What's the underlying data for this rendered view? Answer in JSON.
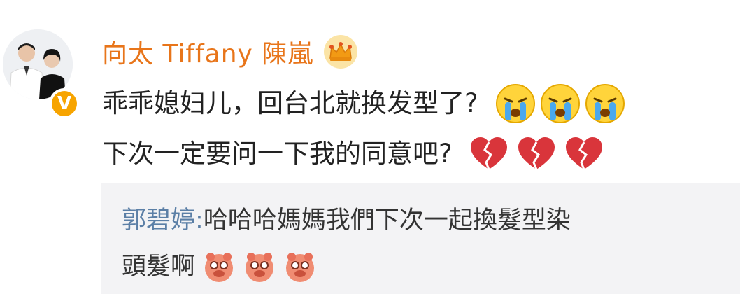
{
  "comment": {
    "author": "向太 Tiffany 陳嵐",
    "author_badge_icon": "crown-icon",
    "verified_badge_letter": "V",
    "lines": [
      {
        "text": "乖乖媳妇儿，回台北就换发型了?",
        "emoji": "crying-face-icon",
        "emoji_count": 3
      },
      {
        "text": "下次一定要问一下我的同意吧?",
        "emoji": "broken-heart-icon",
        "emoji_count": 3
      }
    ]
  },
  "reply": {
    "author": "郭碧婷",
    "separator": ":",
    "line1": " 哈哈哈媽媽我們下次一起換髮型染",
    "line2": "頭髮啊",
    "emoji": "laughing-pig-icon",
    "emoji_count": 3
  },
  "colors": {
    "username": "#e8751a",
    "reply_name": "#5b7fa6",
    "reply_bg": "#f3f3f5",
    "verified": "#f7a400"
  }
}
